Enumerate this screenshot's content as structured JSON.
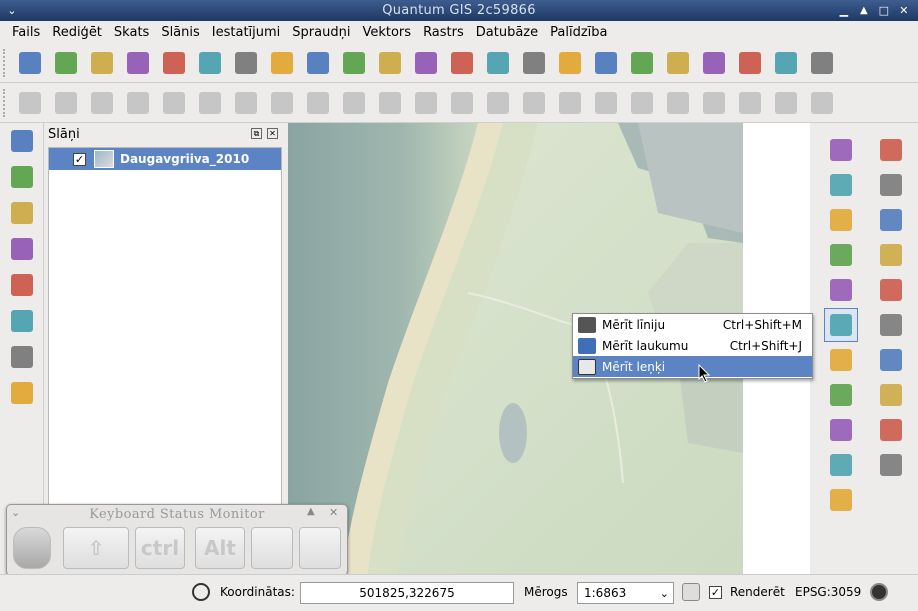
{
  "window": {
    "title": "Quantum GIS 2c59866"
  },
  "menu": [
    "Fails",
    "Rediģēt",
    "Skats",
    "Slānis",
    "Iestatījumi",
    "Spraudņi",
    "Vektors",
    "Rastrs",
    "Datubāze",
    "Palīdzība"
  ],
  "layers_panel": {
    "title": "Slāņi",
    "layers": [
      {
        "name": "Daugavgriiva_2010",
        "checked": true
      }
    ]
  },
  "context_menu": {
    "items": [
      {
        "label": "Mērīt līniju",
        "shortcut": "Ctrl+Shift+M",
        "selected": false
      },
      {
        "label": "Mērīt laukumu",
        "shortcut": "Ctrl+Shift+J",
        "selected": false
      },
      {
        "label": "Mērīt leņķi",
        "shortcut": "",
        "selected": true
      }
    ]
  },
  "keyboard_monitor": {
    "title": "Keyboard Status Monitor",
    "keys": [
      "ctrl",
      "Alt"
    ]
  },
  "status": {
    "coord_label": "Koordinātas:",
    "coord_value": "501825,322675",
    "scale_label": "Mērogs",
    "scale_value": "1:6863",
    "render_label": "Renderēt",
    "render_checked": true,
    "crs": "EPSG:3059"
  },
  "colors": {
    "title_bar": "#2a4673",
    "selection": "#5c84c4",
    "toolbar_bg": "#edeceb"
  },
  "icons": {
    "toolbar1": [
      "new-project-icon",
      "open-project-icon",
      "save-project-icon",
      "save-as-icon",
      "print-composer-icon",
      "print-icon",
      "add-raster-icon",
      "add-wms-icon",
      "add-postgis-icon",
      "add-spatialite-icon",
      "add-mssql-icon",
      "add-wfs-icon",
      "add-vector-icon",
      "new-layer-icon",
      "remove-layer-icon",
      "add-delimited-text-icon",
      "spell-check-icon",
      "style-editor-icon",
      "tag-icon",
      "eye-icon",
      "tag2-icon",
      "tag3-icon",
      "plugin-icon"
    ],
    "toolbar2": [
      "toggle-edit-icon",
      "pencil-icon",
      "save-edits-icon",
      "add-feature-icon",
      "move-feature-icon",
      "node-tool-icon",
      "delete-selected-icon",
      "cut-icon",
      "copy-icon",
      "paste-icon",
      "undo-icon",
      "redo-icon",
      "simplify-icon",
      "add-ring-icon",
      "add-part-icon",
      "delete-ring-icon",
      "delete-part-icon",
      "reshape-icon",
      "offset-curve-icon",
      "split-icon",
      "merge-icon",
      "merge-attributes-icon",
      "rotate-icon"
    ],
    "left": [
      "add-raster-layer-icon",
      "add-vector-layer-icon",
      "histogram-icon",
      "transform-icon",
      "globe-icon",
      "database-icon",
      "help-book-icon",
      "whats-this-icon"
    ],
    "right": [
      "identify-icon",
      "pan-icon",
      "settings-icon",
      "pan-to-selection-icon",
      "select-icon",
      "zoom-in-icon",
      "deselect-icon",
      "zoom-out-icon",
      "attribute-table-icon",
      "zoom-full-icon",
      "measure-icon",
      "zoom-layer-icon",
      "map-tips-icon",
      "zoom-selection-icon",
      "new-bookmark-icon",
      "zoom-last-icon",
      "show-bookmarks-icon",
      "zoom-next-icon",
      "text-annotation-icon",
      "refresh-icon",
      "gps-icon"
    ]
  }
}
